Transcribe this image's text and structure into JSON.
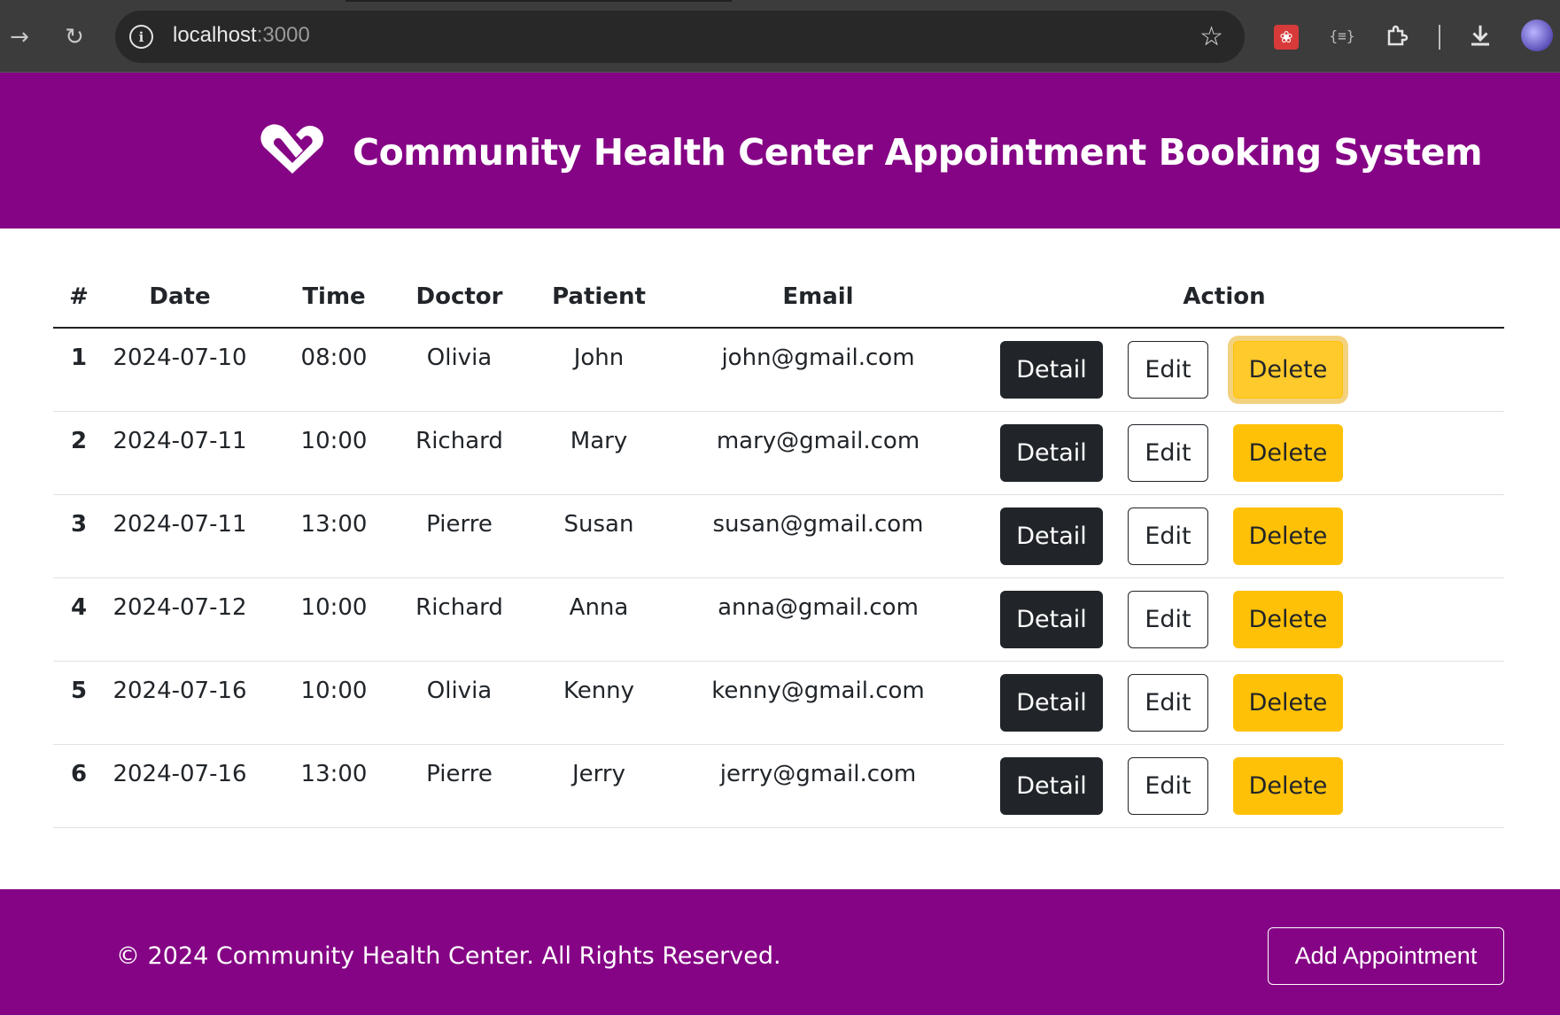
{
  "browser": {
    "url_host": "localhost",
    "url_port": ":3000"
  },
  "header": {
    "title": "Community Health Center Appointment Booking System"
  },
  "table": {
    "columns": [
      "#",
      "Date",
      "Time",
      "Doctor",
      "Patient",
      "Email",
      "Action"
    ],
    "rows": [
      {
        "num": "1",
        "date": "2024-07-10",
        "time": "08:00",
        "doctor": "Olivia",
        "patient": "John",
        "email": "john@gmail.com"
      },
      {
        "num": "2",
        "date": "2024-07-11",
        "time": "10:00",
        "doctor": "Richard",
        "patient": "Mary",
        "email": "mary@gmail.com"
      },
      {
        "num": "3",
        "date": "2024-07-11",
        "time": "13:00",
        "doctor": "Pierre",
        "patient": "Susan",
        "email": "susan@gmail.com"
      },
      {
        "num": "4",
        "date": "2024-07-12",
        "time": "10:00",
        "doctor": "Richard",
        "patient": "Anna",
        "email": "anna@gmail.com"
      },
      {
        "num": "5",
        "date": "2024-07-16",
        "time": "10:00",
        "doctor": "Olivia",
        "patient": "Kenny",
        "email": "kenny@gmail.com"
      },
      {
        "num": "6",
        "date": "2024-07-16",
        "time": "13:00",
        "doctor": "Pierre",
        "patient": "Jerry",
        "email": "jerry@gmail.com"
      }
    ],
    "actions": {
      "detail_label": "Detail",
      "edit_label": "Edit",
      "delete_label": "Delete"
    }
  },
  "footer": {
    "copyright": "© 2024 Community Health Center. All Rights Reserved.",
    "add_button_label": "Add Appointment"
  },
  "colors": {
    "brand_purple": "#850385",
    "detail_bg": "#212529",
    "delete_bg": "#ffc107"
  },
  "icons": [
    "back-arrow-icon",
    "reload-icon",
    "info-icon",
    "star-icon",
    "extension-icon",
    "puzzle-icon",
    "download-icon",
    "heart-logo-icon"
  ]
}
